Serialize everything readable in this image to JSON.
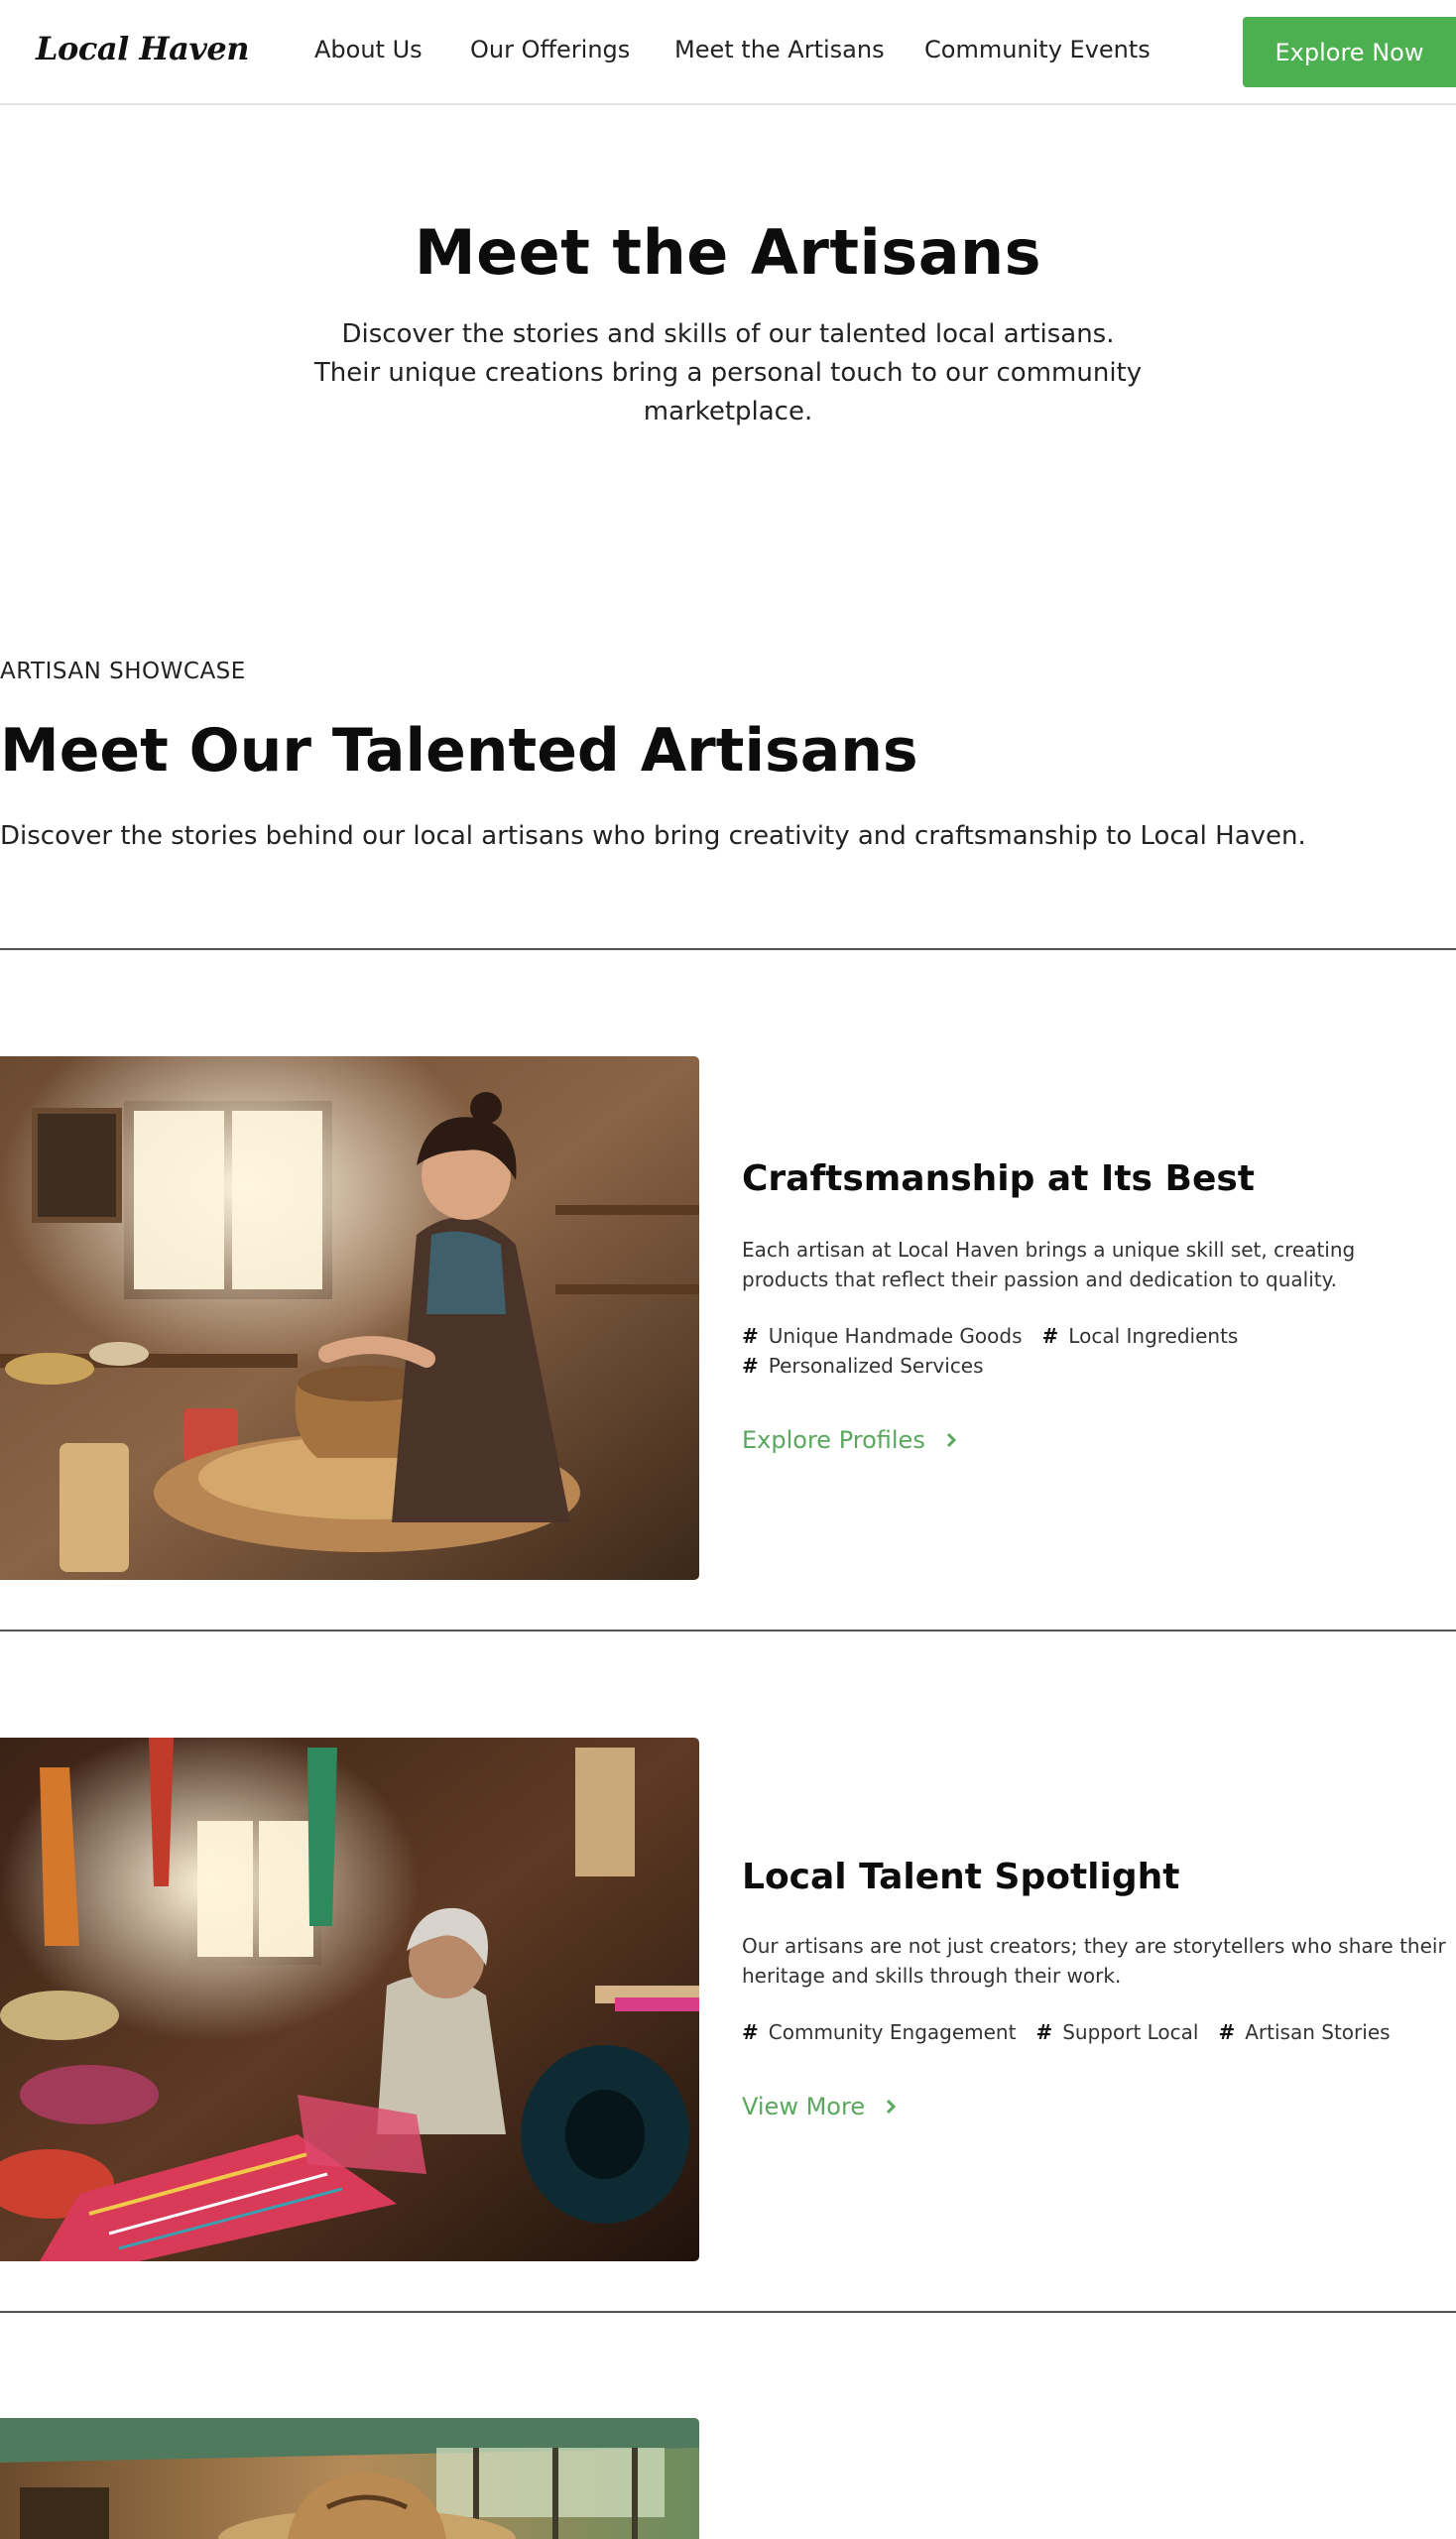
{
  "header": {
    "logo": "Local Haven",
    "nav": [
      {
        "label": "About Us"
      },
      {
        "label": "Our Offerings"
      },
      {
        "label": "Meet the Artisans"
      },
      {
        "label": "Community Events"
      }
    ],
    "cta_label": "Explore Now"
  },
  "hero": {
    "title": "Meet the Artisans",
    "subtitle": "Discover the stories and skills of our talented local artisans. Their unique creations bring a personal touch to our community marketplace."
  },
  "showcase": {
    "eyebrow": "ARTISAN SHOWCASE",
    "title": "Meet Our Talented Artisans",
    "subtitle": "Discover the stories behind our local artisans who bring creativity and craftsmanship to Local Haven."
  },
  "cards": [
    {
      "title": "Craftsmanship at Its Best",
      "description": "Each artisan at Local Haven brings a unique skill set, creating products that reflect their passion and dedication to quality.",
      "tags": [
        "Unique Handmade Goods",
        "Local Ingredients",
        "Personalized Services"
      ],
      "link_label": "Explore Profiles"
    },
    {
      "title": "Local Talent Spotlight",
      "description": "Our artisans are not just creators; they are storytellers who share their heritage and skills through their work.",
      "tags": [
        "Community Engagement",
        "Support Local",
        "Artisan Stories"
      ],
      "link_label": "View More"
    }
  ],
  "colors": {
    "accent": "#4caf50",
    "link": "#5aa75e"
  }
}
